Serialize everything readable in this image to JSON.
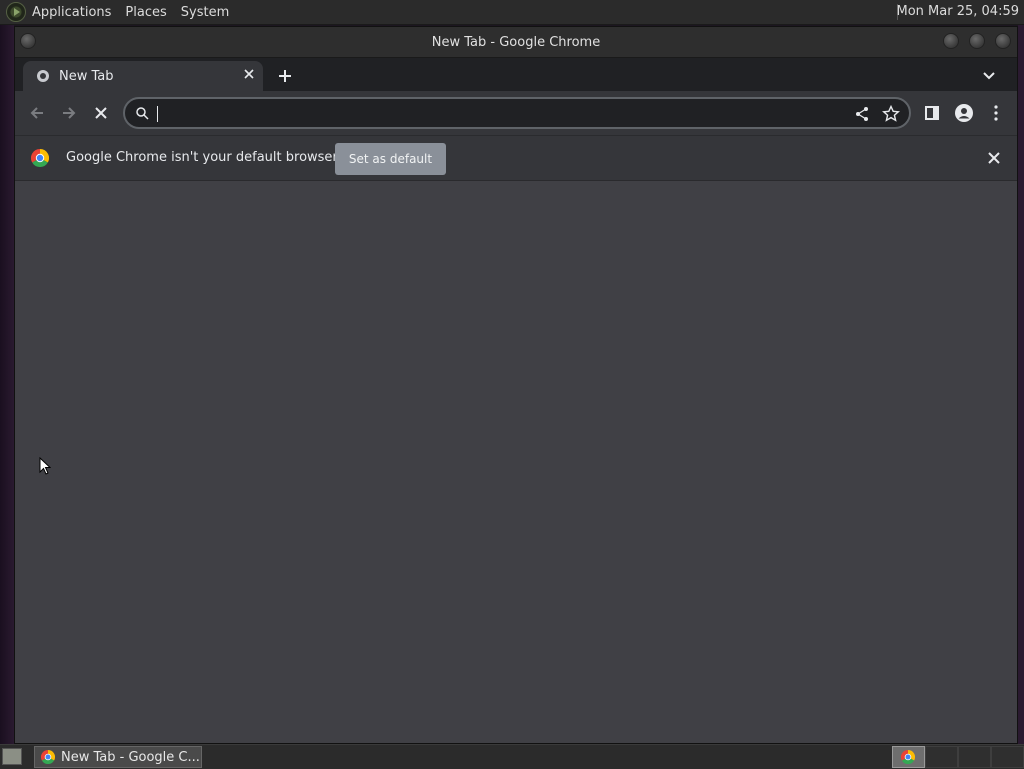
{
  "top_panel": {
    "menus": [
      "Applications",
      "Places",
      "System"
    ],
    "clock": "Mon Mar 25, 04:59"
  },
  "window": {
    "title": "New Tab - Google Chrome"
  },
  "tabs": [
    {
      "title": "New Tab",
      "active": true
    }
  ],
  "toolbar": {
    "address_value": ""
  },
  "infobar": {
    "message": "Google Chrome isn't your default browser",
    "button_label": "Set as default"
  },
  "taskbar": {
    "tasks": [
      {
        "label": "New Tab - Google C..."
      }
    ],
    "workspaces": 4
  },
  "colors": {
    "content_bg": "#404045",
    "toolbar_bg": "#35363a",
    "tabstrip_bg": "#202124",
    "button_bg": "#8a9099"
  },
  "icons": [
    "mate-logo-icon",
    "chrome-favicon-icon",
    "close-icon",
    "plus-icon",
    "chevron-down-icon",
    "back-arrow-icon",
    "forward-arrow-icon",
    "stop-icon",
    "search-icon",
    "share-icon",
    "star-icon",
    "side-panel-icon",
    "profile-icon",
    "more-vert-icon",
    "chrome-logo-icon",
    "show-desktop-icon",
    "mouse-cursor-icon"
  ]
}
